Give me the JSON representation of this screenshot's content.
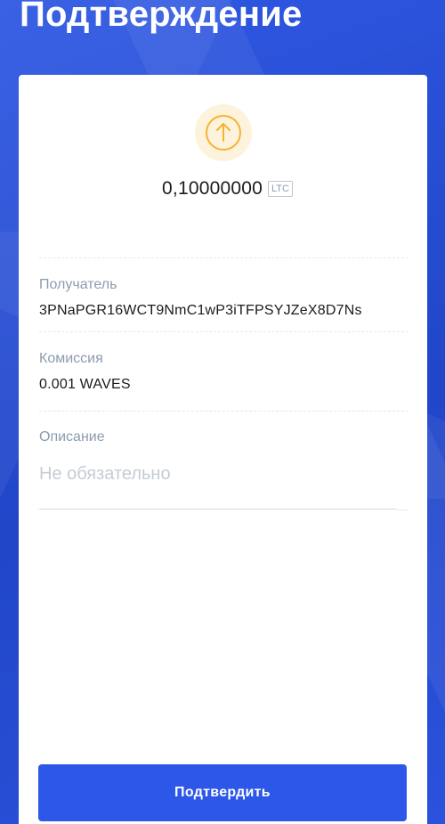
{
  "header": {
    "title": "Подтверждение"
  },
  "transaction": {
    "icon": "arrow-up-circle-icon",
    "amount": "0,10000000",
    "ticker": "LTC"
  },
  "recipient": {
    "label": "Получатель",
    "value": "3PNaPGR16WCT9NmC1wP3iTFPSYJZeX8D7Ns"
  },
  "fee": {
    "label": "Комиссия",
    "value": "0.001 WAVES"
  },
  "description": {
    "label": "Описание",
    "placeholder": "Не обязательно",
    "value": ""
  },
  "actions": {
    "confirm_label": "Подтвердить"
  },
  "colors": {
    "background": "#2a4fd6",
    "accent": "#2d57e8",
    "icon_orange": "#f5b330",
    "icon_bg": "#fdf3dc",
    "label_gray": "#8c9bb0"
  }
}
